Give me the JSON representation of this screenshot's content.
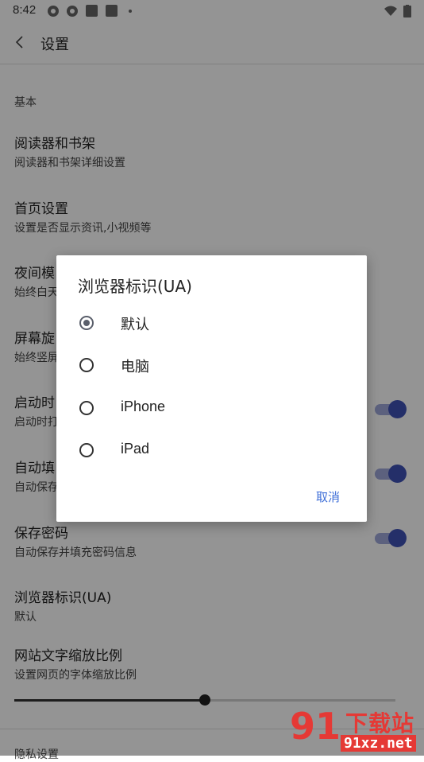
{
  "status_bar": {
    "time": "8:42"
  },
  "appbar": {
    "title": "设置"
  },
  "section": {
    "label": "基本"
  },
  "settings": [
    {
      "title": "阅读器和书架",
      "subtitle": "阅读器和书架详细设置"
    },
    {
      "title": "首页设置",
      "subtitle": "设置是否显示资讯,小视频等"
    },
    {
      "title": "夜间模",
      "subtitle": "始终白天"
    },
    {
      "title": "屏幕旋",
      "subtitle": "始终竖屏"
    },
    {
      "title": "启动时",
      "subtitle": "启动时打",
      "toggle": true
    },
    {
      "title": "自动填",
      "subtitle": "自动保存",
      "toggle": true
    },
    {
      "title": "保存密码",
      "subtitle": "自动保存并填充密码信息",
      "toggle": true
    },
    {
      "title": "浏览器标识(UA)",
      "subtitle": "默认"
    },
    {
      "title": "网站文字缩放比例",
      "subtitle": "设置网页的字体缩放比例"
    }
  ],
  "slider": {
    "value_fraction": 0.5
  },
  "next_section": {
    "label": "隐私设置"
  },
  "dialog": {
    "title": "浏览器标识(UA)",
    "options": [
      {
        "label": "默认",
        "selected": true
      },
      {
        "label": "电脑",
        "selected": false
      },
      {
        "label": "iPhone",
        "selected": false
      },
      {
        "label": "iPad",
        "selected": false
      }
    ],
    "cancel_label": "取消"
  },
  "watermark": {
    "logo": "91",
    "title": "下载站",
    "url": "91xz.net"
  },
  "colors": {
    "accent": "#3f51b5",
    "accent_track": "#9fa8da",
    "link": "#3f6fd8",
    "watermark": "#e53935"
  }
}
